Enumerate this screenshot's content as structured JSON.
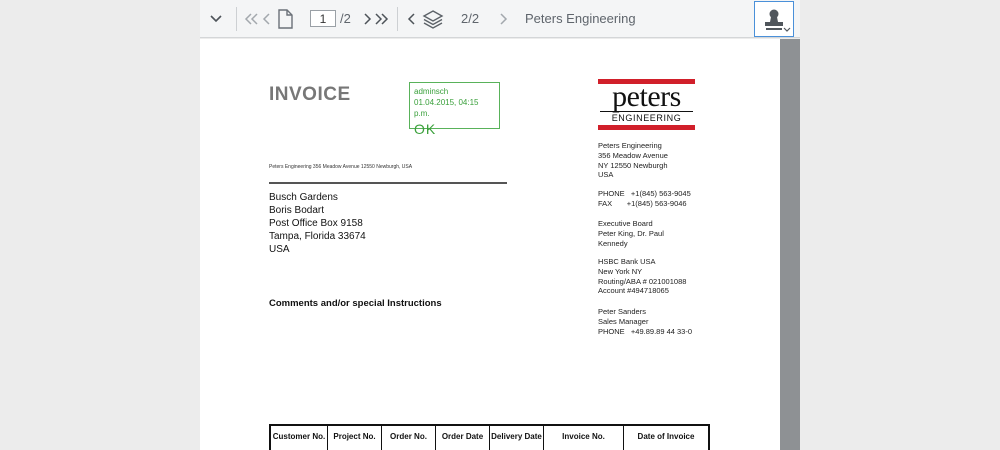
{
  "toolbar": {
    "page_current": "1",
    "page_total": "/2",
    "attachment_count": "2/2",
    "document_name": "Peters Engineering"
  },
  "document": {
    "title": "INVOICE",
    "approval_stamp": {
      "user": "adminsch",
      "datetime": "01.04.2015, 04:15 p.m.",
      "status": "OK",
      "color": "#3aa03b"
    },
    "sender_line": "Peters Engineering  356 Meadow Avenue  12550 Newburgh, USA",
    "recipient": [
      "Busch Gardens",
      "Boris Bodart",
      "Post Office Box 9158",
      "Tampa, Florida  33674",
      "USA"
    ],
    "comments_heading": "Comments and/or special Instructions",
    "logo": {
      "word": "peters",
      "sub": "ENGINEERING",
      "brand_color": "#d11f2a"
    },
    "company_address": [
      "Peters Engineering",
      "356 Meadow Avenue",
      "NY 12550 Newburgh",
      "USA"
    ],
    "contact": [
      "PHONE   +1(845) 563-9045",
      "FAX       +1(845) 563-9046"
    ],
    "board": [
      "Executive Board",
      "Peter King, Dr. Paul",
      "Kennedy"
    ],
    "bank": [
      "HSBC Bank USA",
      "New York NY",
      "Routing/ABA # 021001088",
      "Account #494718065"
    ],
    "manager": [
      "Peter Sanders",
      "Sales Manager",
      "PHONE   +49.89.89 44 33-0"
    ],
    "table_headers": [
      "Customer No.",
      "Project No.",
      "Order No.",
      "Order Date",
      "Delivery Date",
      "Invoice No.",
      "Date of Invoice"
    ]
  }
}
